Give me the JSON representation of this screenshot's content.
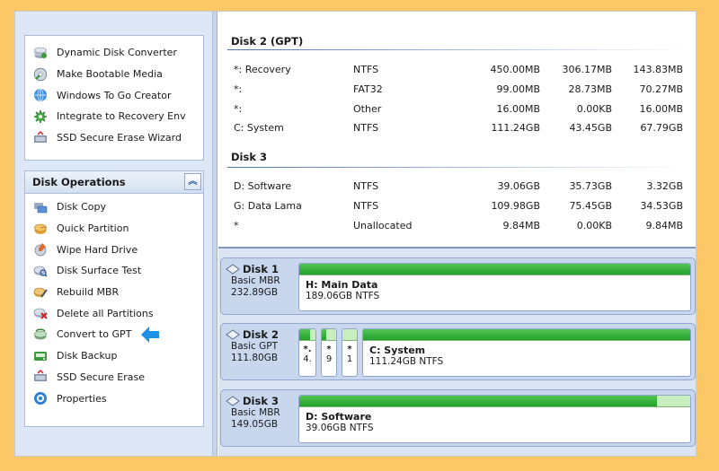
{
  "sidebar": {
    "wizards": [
      {
        "label": "Dynamic Disk Converter",
        "icon": "dynamic-disk-icon"
      },
      {
        "label": "Make Bootable Media",
        "icon": "bootable-media-icon"
      },
      {
        "label": "Windows To Go Creator",
        "icon": "windows-to-go-icon"
      },
      {
        "label": "Integrate to Recovery Env",
        "icon": "recovery-env-icon"
      },
      {
        "label": "SSD Secure Erase Wizard",
        "icon": "ssd-erase-wizard-icon"
      }
    ],
    "ops_title": "Disk Operations",
    "collapse_glyph": "︽",
    "ops": [
      {
        "label": "Disk Copy",
        "icon": "disk-copy-icon"
      },
      {
        "label": "Quick Partition",
        "icon": "quick-partition-icon"
      },
      {
        "label": "Wipe Hard Drive",
        "icon": "wipe-drive-icon"
      },
      {
        "label": "Disk Surface Test",
        "icon": "surface-test-icon"
      },
      {
        "label": "Rebuild MBR",
        "icon": "rebuild-mbr-icon"
      },
      {
        "label": "Delete all Partitions",
        "icon": "delete-partitions-icon"
      },
      {
        "label": "Convert to GPT",
        "icon": "convert-gpt-icon"
      },
      {
        "label": "Disk Backup",
        "icon": "disk-backup-icon"
      },
      {
        "label": "SSD Secure Erase",
        "icon": "ssd-erase-icon"
      },
      {
        "label": "Properties",
        "icon": "properties-icon"
      }
    ]
  },
  "table": {
    "disk2": {
      "title": "Disk 2 (GPT)",
      "rows": [
        {
          "name": "*: Recovery",
          "fs": "NTFS",
          "capacity": "450.00MB",
          "used": "306.17MB",
          "free": "143.83MB"
        },
        {
          "name": "*:",
          "fs": "FAT32",
          "capacity": "99.00MB",
          "used": "28.73MB",
          "free": "70.27MB"
        },
        {
          "name": "*:",
          "fs": "Other",
          "capacity": "16.00MB",
          "used": "0.00KB",
          "free": "16.00MB"
        },
        {
          "name": "C: System",
          "fs": "NTFS",
          "capacity": "111.24GB",
          "used": "43.45GB",
          "free": "67.79GB"
        }
      ]
    },
    "disk3": {
      "title": "Disk 3",
      "rows": [
        {
          "name": "D: Software",
          "fs": "NTFS",
          "capacity": "39.06GB",
          "used": "35.73GB",
          "free": "3.32GB"
        },
        {
          "name": "G: Data Lama",
          "fs": "NTFS",
          "capacity": "109.98GB",
          "used": "75.45GB",
          "free": "34.53GB"
        },
        {
          "name": "*",
          "fs": "Unallocated",
          "capacity": "9.84MB",
          "used": "0.00KB",
          "free": "9.84MB"
        }
      ]
    }
  },
  "diskmap": {
    "disk1": {
      "name": "Disk 1",
      "type": "Basic MBR",
      "size": "232.89GB",
      "partitions": [
        {
          "name": "H: Main Data",
          "info": "189.06GB NTFS",
          "used_fraction": 1.0
        }
      ]
    },
    "disk2": {
      "name": "Disk 2",
      "type": "Basic GPT",
      "size": "111.80GB",
      "small_partitions": [
        {
          "name": "*.",
          "info": "4.",
          "used_fraction": 0.68
        },
        {
          "name": "*",
          "info": "9",
          "used_fraction": 0.29
        },
        {
          "name": "*",
          "info": "1",
          "used_fraction": 0.0
        }
      ],
      "partitions": [
        {
          "name": "C: System",
          "info": "111.24GB NTFS",
          "used_fraction": 1.0
        }
      ]
    },
    "disk3": {
      "name": "Disk 3",
      "type": "Basic MBR",
      "size": "149.05GB",
      "partitions": [
        {
          "name": "D: Software",
          "info": "39.06GB NTFS",
          "used_fraction": 0.915
        }
      ]
    }
  },
  "colors": {
    "highlight_arrow": "#1e90e6",
    "usage_fill": "#2aa832",
    "usage_empty": "#c8eebf"
  }
}
